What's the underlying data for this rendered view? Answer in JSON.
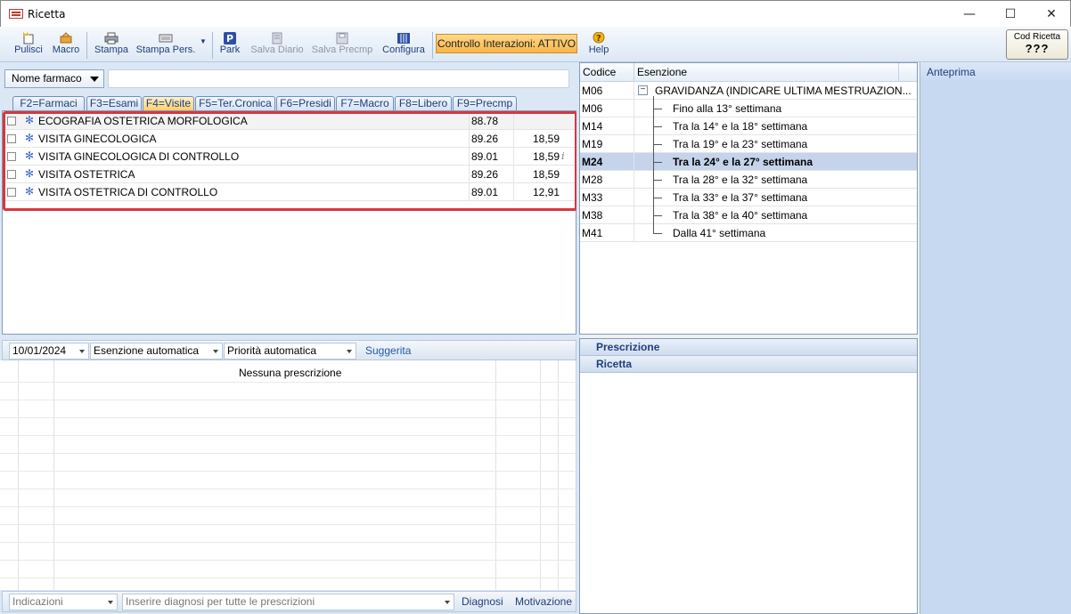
{
  "window": {
    "title": "Ricetta"
  },
  "toolbar": {
    "pulisci": "Pulisci",
    "macro": "Macro",
    "stampa": "Stampa",
    "stampa_pers": "Stampa Pers.",
    "park": "Park",
    "salva_diario": "Salva Diario",
    "salva_precmp": "Salva Precmp",
    "configura": "Configura",
    "controllo": "Controllo Interazioni: ATTIVO",
    "help": "Help",
    "cod_ricetta_label": "Cod Ricetta",
    "cod_ricetta_value": "???"
  },
  "search": {
    "dropdown": "Nome farmaco",
    "value": ""
  },
  "tabs": [
    "F2=Farmaci",
    "F3=Esami",
    "F4=Visite",
    "F5=Ter.Cronica",
    "F6=Presidi",
    "F7=Macro",
    "F8=Libero",
    "F9=Precmp"
  ],
  "active_tab": "F4=Visite",
  "items": [
    {
      "name": "ECOGRAFIA OSTETRICA MORFOLOGICA",
      "code": "88.78",
      "price": ""
    },
    {
      "name": "VISITA GINECOLOGICA",
      "code": "89.26",
      "price": "18,59"
    },
    {
      "name": "VISITA GINECOLOGICA DI CONTROLLO",
      "code": "89.01",
      "price": "18,59"
    },
    {
      "name": "VISITA OSTETRICA",
      "code": "89.26",
      "price": "18,59"
    },
    {
      "name": "VISITA OSTETRICA DI CONTROLLO",
      "code": "89.01",
      "price": "12,91"
    }
  ],
  "info_icon": "i",
  "midbar": {
    "date": "10/01/2024",
    "esenzione": "Esenzione automatica",
    "priorita": "Priorità automatica",
    "suggerita": "Suggerita"
  },
  "prescrizioni": {
    "empty": "Nessuna prescrizione"
  },
  "bottombar": {
    "indicazioni": "Indicazioni",
    "diagnosi_placeholder": "Inserire diagnosi per tutte le prescrizioni",
    "diagnosi": "Diagnosi",
    "motivazione": "Motivazione"
  },
  "esenzioni": {
    "col_codice": "Codice",
    "col_esenzione": "Esenzione",
    "rows": [
      {
        "code": "M06",
        "text": "GRAVIDANZA (INDICARE ULTIMA MESTRUAZION..."
      },
      {
        "code": "M06",
        "text": "Fino alla 13° settimana"
      },
      {
        "code": "M14",
        "text": "Tra la 14° e la 18° settimana"
      },
      {
        "code": "M19",
        "text": "Tra la 19° e la 23° settimana"
      },
      {
        "code": "M24",
        "text": "Tra la 24° e la 27° settimana"
      },
      {
        "code": "M28",
        "text": "Tra la 28° e la 32° settimana"
      },
      {
        "code": "M33",
        "text": "Tra la 33° e la 37° settimana"
      },
      {
        "code": "M38",
        "text": "Tra la 38° e la 40° settimana"
      },
      {
        "code": "M41",
        "text": "Dalla 41° settimana"
      }
    ],
    "selected_code": "M24"
  },
  "right_sections": {
    "prescrizione": "Prescrizione",
    "ricetta": "Ricetta"
  },
  "anteprima": {
    "title": "Anteprima"
  },
  "colors": {
    "highlight": "#d9363e",
    "selected_row": "#c5d4eb",
    "accent": "#1e3f7a",
    "interaz": "#f9b447"
  }
}
